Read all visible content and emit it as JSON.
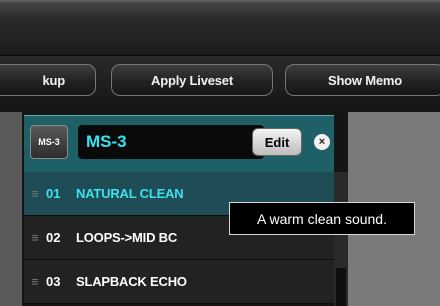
{
  "toolbar": {
    "backup_label": "kup",
    "apply_liveset_label": "Apply Liveset",
    "show_memo_label": "Show Memo"
  },
  "device": {
    "logo_text": "MS-3",
    "name": "MS-3",
    "edit_label": "Edit",
    "close_glyph": "×"
  },
  "patches": [
    {
      "number": "01",
      "name": "NATURAL CLEAN",
      "selected": true
    },
    {
      "number": "02",
      "name": "LOOPS->MID BC",
      "selected": false
    },
    {
      "number": "03",
      "name": "SLAPBACK ECHO",
      "selected": false
    }
  ],
  "tooltip": {
    "text": "A warm clean sound."
  },
  "icons": {
    "drag_handle": "≡"
  },
  "colors": {
    "accent": "#3ee0ee",
    "header_bg": "#1f5f66",
    "selected_row": "#1f4d55"
  }
}
